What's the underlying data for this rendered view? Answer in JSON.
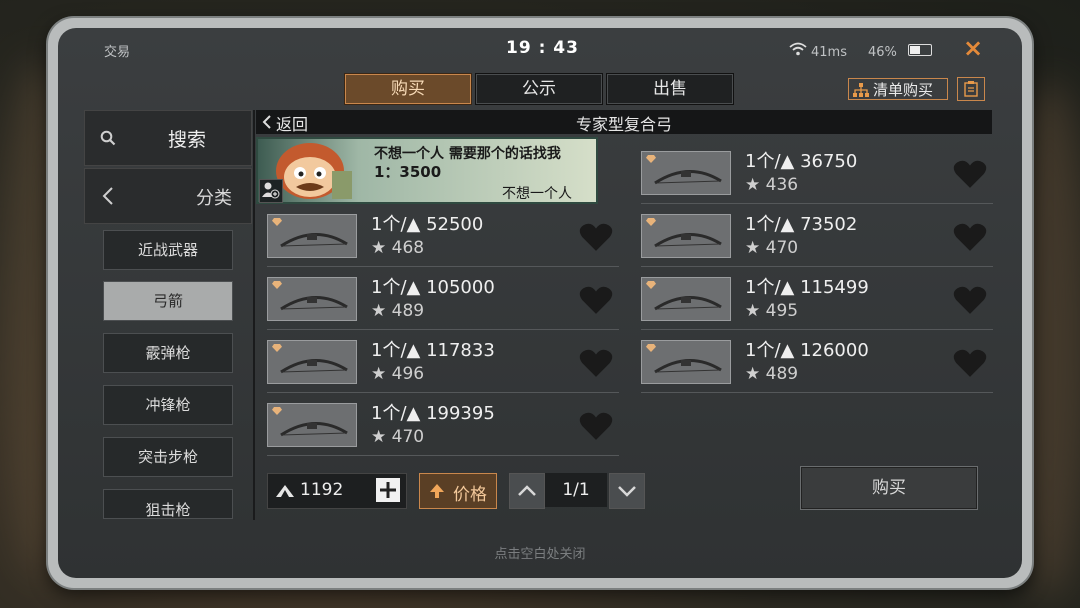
{
  "window": {
    "title": "交易",
    "close_icon": "×"
  },
  "status": {
    "time": "19 : 43",
    "ping": "41ms",
    "battery": "46%"
  },
  "tabs": [
    {
      "label": "购买",
      "active": true
    },
    {
      "label": "公示",
      "active": false
    },
    {
      "label": "出售",
      "active": false
    }
  ],
  "list_buy": {
    "label": "清单购买"
  },
  "sidebar": {
    "search_label": "搜索",
    "category_label": "分类",
    "categories": [
      {
        "label": "近战武器",
        "selected": false
      },
      {
        "label": "弓箭",
        "selected": true
      },
      {
        "label": "霰弹枪",
        "selected": false
      },
      {
        "label": "冲锋枪",
        "selected": false
      },
      {
        "label": "突击步枪",
        "selected": false
      },
      {
        "label": "狙击枪",
        "selected": false
      }
    ]
  },
  "header": {
    "back_label": "返回",
    "title": "专家型复合弓"
  },
  "ad": {
    "line1": "不想一个人 需要那个的话找我",
    "line2": "1：3500",
    "seller": "不想一个人"
  },
  "listings": [
    {
      "price": "1个/▲ 36750",
      "rating": "436"
    },
    {
      "price": "1个/▲ 52500",
      "rating": "468"
    },
    {
      "price": "1个/▲ 73502",
      "rating": "470"
    },
    {
      "price": "1个/▲ 105000",
      "rating": "489"
    },
    {
      "price": "1个/▲ 115499",
      "rating": "495"
    },
    {
      "price": "1个/▲ 117833",
      "rating": "496"
    },
    {
      "price": "1个/▲ 126000",
      "rating": "489"
    },
    {
      "price": "1个/▲ 199395",
      "rating": "470"
    }
  ],
  "footer": {
    "balance": "1192",
    "sort_label": "价格",
    "page": "1/1",
    "buy_label": "购买",
    "hint": "点击空白处关闭"
  },
  "colors": {
    "accent": "#c9874c",
    "panel": "#2f3233"
  }
}
